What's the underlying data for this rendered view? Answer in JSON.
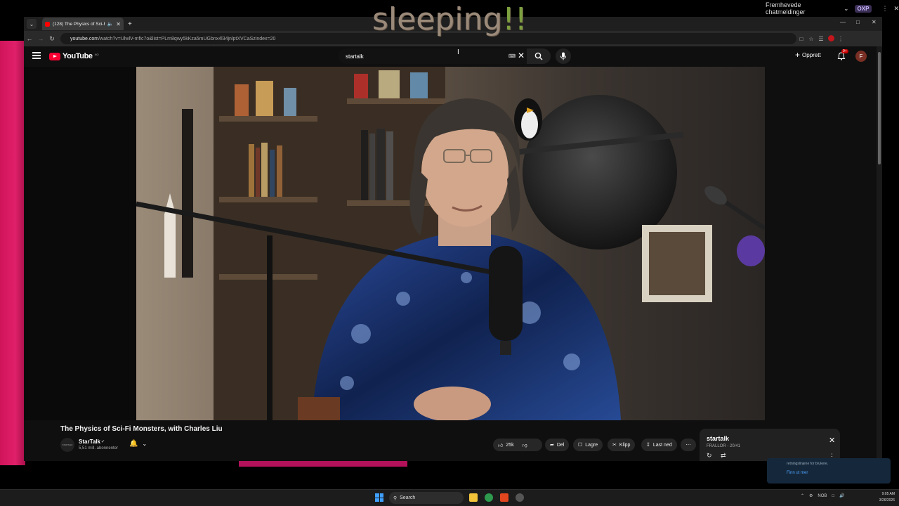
{
  "overlay": {
    "text_a": "sleeping",
    "text_b": "!!"
  },
  "stream_topbar": {
    "label": "Fremhevede chatmeldinger",
    "badge": "OXP"
  },
  "tab": {
    "title": "(128) The Physics of Sci-Fi I"
  },
  "address": {
    "host": "youtube.com",
    "path": "/watch?v=UlwlV-mfic7o&list=PLm8qwy5kKza5mUGbnx4l34jnlptXVCaSzindex=20"
  },
  "masthead": {
    "logo": "YouTube",
    "logo_cc": "NO",
    "search_value": "startalk",
    "create_label": "Opprett",
    "notif_badge": "9+",
    "avatar_letter": "F"
  },
  "video": {
    "title": "The Physics of Sci-Fi Monsters, with Charles Liu",
    "channel": "StarTalk",
    "channel_avatar_text": "STARTALK",
    "subscribers": "5,51 mill. abonnenter",
    "likes": "25k",
    "share_label": "Del",
    "save_label": "Lagre",
    "clip_label": "Klipp",
    "download_label": "Last ned"
  },
  "playlist": {
    "title": "startalk",
    "subtitle": "FRALLOR - 20/41"
  },
  "toast": {
    "line1": "retningslinjene for brukere.",
    "link": "Finn ut mer"
  },
  "taskbar": {
    "search_label": "Search",
    "lang": "NOB",
    "time": "9:05 AM",
    "date": "3/26/2026"
  },
  "colors": {
    "yt_red": "#ff0033",
    "accent_blue": "#3fa0ff",
    "pink_backdrop": "#d0145a"
  }
}
